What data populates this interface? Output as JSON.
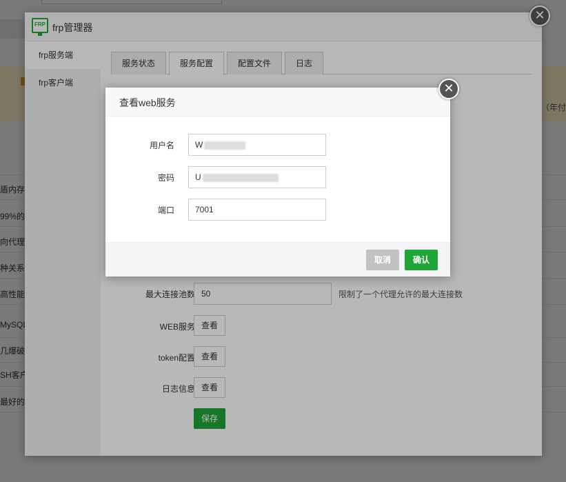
{
  "background": {
    "warning_tail": "（年付",
    "rows": [
      "盾内存少",
      "99%的",
      "向代理(P",
      "种关系数",
      "高性能的",
      "MySQL",
      "几爆破服",
      "SH客户",
      "最好的"
    ]
  },
  "frp": {
    "logo_text": "FRP",
    "title": "frp管理器",
    "close_glyph": "✕",
    "sidebar": [
      {
        "label": "frp服务端",
        "active": true
      },
      {
        "label": "frp客户端",
        "active": false
      }
    ],
    "tabs": [
      {
        "label": "服务状态",
        "active": false
      },
      {
        "label": "服务配置",
        "active": true
      },
      {
        "label": "配置文件",
        "active": false
      },
      {
        "label": "日志",
        "active": false
      }
    ],
    "form": {
      "max_pool_label": "最大连接池数",
      "max_pool_value": "50",
      "max_pool_tip": "限制了一个代理允许的最大连接数",
      "web_label": "WEB服务",
      "token_label": "token配置",
      "log_label": "日志信息",
      "view_label": "查看",
      "save_label": "保存"
    }
  },
  "dialog": {
    "title": "查看web服务",
    "close_glyph": "✕",
    "username_label": "用户名",
    "username_prefix": "W",
    "password_label": "密码",
    "password_prefix": "U",
    "port_label": "端口",
    "port_value": "7001",
    "cancel_label": "取消",
    "ok_label": "确认"
  },
  "colors": {
    "accent_green": "#20a53a",
    "cancel_gray": "#c2c2c2",
    "warning_bg": "#fff3cd"
  }
}
